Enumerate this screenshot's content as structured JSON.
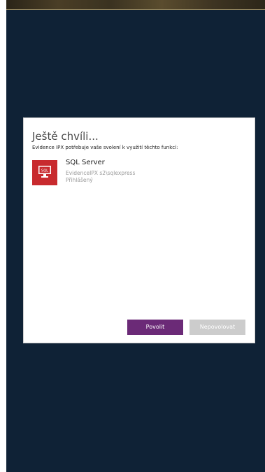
{
  "dialog": {
    "title": "Ještě chvíli...",
    "subtitle": "Evidence IPX potřebuje vaše svolení k využití těchto funkcí:",
    "capability": {
      "icon": "database-monitor-icon",
      "icon_text": "SQL",
      "name": "SQL Server",
      "detail": "EvidenceIPX s2\\sqlexpress",
      "status": "Přihlášený"
    },
    "allow_label": "Povolit",
    "deny_label": "Nepovolovat"
  },
  "colors": {
    "background": "#0f2236",
    "accent_purple": "#6b2a77",
    "icon_red": "#c82a2e",
    "disabled_gray": "#cccccc"
  }
}
